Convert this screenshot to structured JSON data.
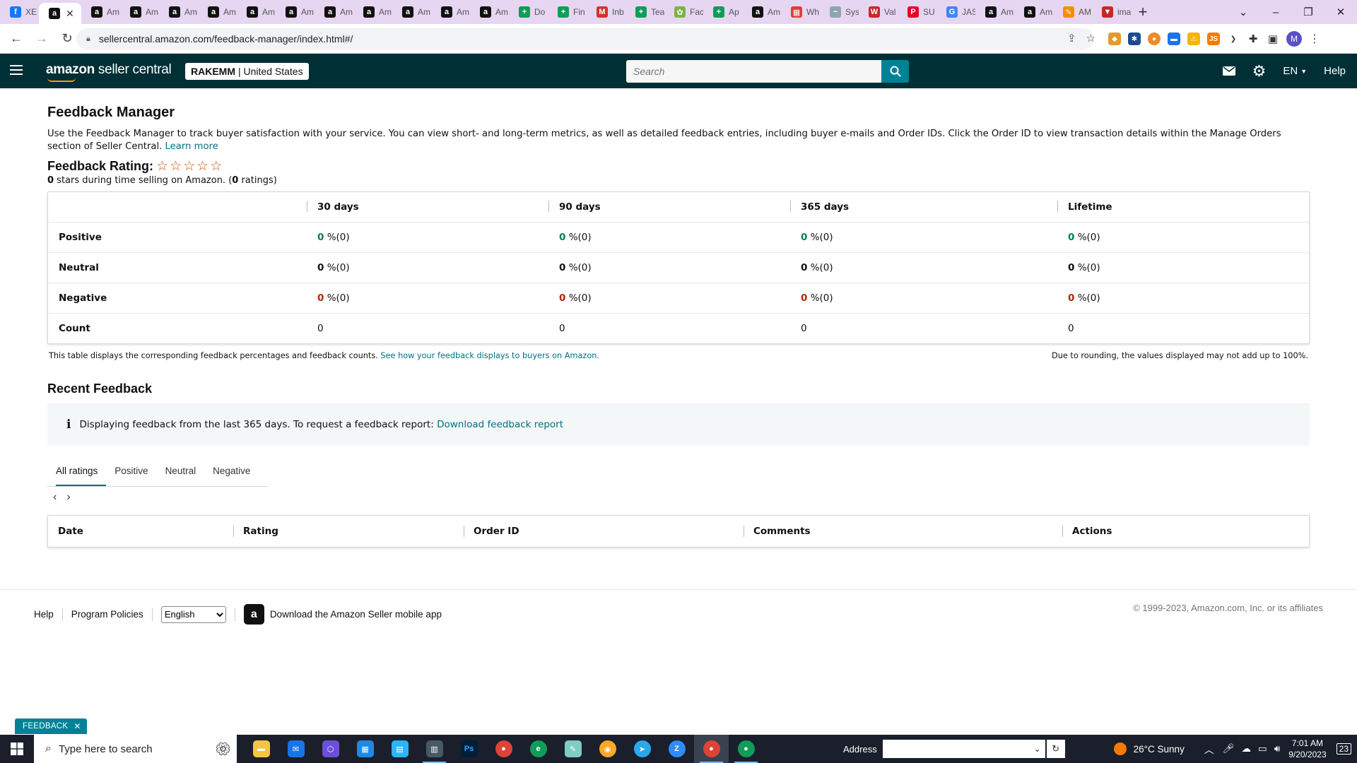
{
  "browser": {
    "tabs": [
      {
        "title": "XE",
        "fav": "facebook-icon",
        "color": "#1877f2",
        "glyph": "f"
      },
      {
        "title": "",
        "fav": "amazon-icon",
        "color": "#111111",
        "glyph": "a",
        "active": true
      },
      {
        "title": "Am",
        "fav": "amazon-icon",
        "color": "#111111",
        "glyph": "a"
      },
      {
        "title": "Am",
        "fav": "amazon-icon",
        "color": "#111111",
        "glyph": "a"
      },
      {
        "title": "Am",
        "fav": "amazon-icon",
        "color": "#111111",
        "glyph": "a"
      },
      {
        "title": "Am",
        "fav": "amazon-icon",
        "color": "#111111",
        "glyph": "a"
      },
      {
        "title": "Am",
        "fav": "amazon-icon",
        "color": "#111111",
        "glyph": "a"
      },
      {
        "title": "Am",
        "fav": "amazon-icon",
        "color": "#111111",
        "glyph": "a"
      },
      {
        "title": "Am",
        "fav": "amazon-icon",
        "color": "#111111",
        "glyph": "a"
      },
      {
        "title": "Am",
        "fav": "amazon-icon",
        "color": "#111111",
        "glyph": "a"
      },
      {
        "title": "Am",
        "fav": "amazon-icon",
        "color": "#111111",
        "glyph": "a"
      },
      {
        "title": "Am",
        "fav": "amazon-icon",
        "color": "#111111",
        "glyph": "a"
      },
      {
        "title": "Am",
        "fav": "amazon-icon",
        "color": "#111111",
        "glyph": "a"
      },
      {
        "title": "Do",
        "fav": "sheets-plus-icon",
        "color": "#0f9d58",
        "glyph": "+"
      },
      {
        "title": "Fin",
        "fav": "sheets-plus-icon",
        "color": "#0f9d58",
        "glyph": "+"
      },
      {
        "title": "Inb",
        "fav": "gmail-icon",
        "color": "#d93025",
        "glyph": "M"
      },
      {
        "title": "Tea",
        "fav": "sheets-plus-icon",
        "color": "#0f9d58",
        "glyph": "+"
      },
      {
        "title": "Fac",
        "fav": "leaf-icon",
        "color": "#7cb342",
        "glyph": "✿"
      },
      {
        "title": "Ap",
        "fav": "sheets-plus-icon",
        "color": "#0f9d58",
        "glyph": "+"
      },
      {
        "title": "Am",
        "fav": "amazon-icon",
        "color": "#111111",
        "glyph": "a"
      },
      {
        "title": "Wh",
        "fav": "grid-icon",
        "color": "#e53935",
        "glyph": "▦"
      },
      {
        "title": "Sys",
        "fav": "sys-icon",
        "color": "#90a4ae",
        "glyph": "~"
      },
      {
        "title": "Val",
        "fav": "val-icon",
        "color": "#c62828",
        "glyph": "W"
      },
      {
        "title": "SU",
        "fav": "pinterest-icon",
        "color": "#e60023",
        "glyph": "P"
      },
      {
        "title": "JAS",
        "fav": "google-icon",
        "color": "#4285f4",
        "glyph": "G"
      },
      {
        "title": "Am",
        "fav": "amazon-icon",
        "color": "#111111",
        "glyph": "a"
      },
      {
        "title": "Am",
        "fav": "amazon-icon",
        "color": "#111111",
        "glyph": "a"
      },
      {
        "title": "AM",
        "fav": "pencil-icon",
        "color": "#fb8c00",
        "glyph": "✎"
      },
      {
        "title": "ima",
        "fav": "triangle-icon",
        "color": "#c62828",
        "glyph": "▼"
      }
    ],
    "url": "sellercentral.amazon.com/feedback-manager/index.html#/"
  },
  "header": {
    "logo_bold": "amazon",
    "logo_rest": " seller central",
    "store_name": "RAKEMM",
    "store_region": "| United States",
    "search_placeholder": "Search",
    "language": "EN",
    "help": "Help",
    "accent": "#008296",
    "bg": "#002f36"
  },
  "page": {
    "title": "Feedback Manager",
    "intro": "Use the Feedback Manager to track buyer satisfaction with your service. You can view short- and long-term metrics, as well as detailed feedback entries, including buyer e-mails and Order IDs. Click the Order ID to view transaction details within the Manage Orders section of Seller Central.",
    "learn_more": "Learn more",
    "rating_label": "Feedback Rating:",
    "rating_stars": 0,
    "rating_sub_value": "0",
    "rating_sub_text": " stars during time selling on Amazon. (",
    "rating_sub_count": "0",
    "rating_sub_end": " ratings)"
  },
  "metrics": {
    "columns": [
      "",
      "30 days",
      "90 days",
      "365 days",
      "Lifetime"
    ],
    "rows": [
      {
        "label": "Positive",
        "kind": "pos",
        "cells": [
          {
            "v": "0",
            "p": "%(0)"
          },
          {
            "v": "0",
            "p": "%(0)"
          },
          {
            "v": "0",
            "p": "%(0)"
          },
          {
            "v": "0",
            "p": "%(0)"
          }
        ]
      },
      {
        "label": "Neutral",
        "kind": "neu",
        "cells": [
          {
            "v": "0",
            "p": "%(0)"
          },
          {
            "v": "0",
            "p": "%(0)"
          },
          {
            "v": "0",
            "p": "%(0)"
          },
          {
            "v": "0",
            "p": "%(0)"
          }
        ]
      },
      {
        "label": "Negative",
        "kind": "neg",
        "cells": [
          {
            "v": "0",
            "p": "%(0)"
          },
          {
            "v": "0",
            "p": "%(0)"
          },
          {
            "v": "0",
            "p": "%(0)"
          },
          {
            "v": "0",
            "p": "%(0)"
          }
        ]
      },
      {
        "label": "Count",
        "kind": "count",
        "cells": [
          {
            "v": "0",
            "p": ""
          },
          {
            "v": "0",
            "p": ""
          },
          {
            "v": "0",
            "p": ""
          },
          {
            "v": "0",
            "p": ""
          }
        ]
      }
    ],
    "note_left": "This table displays the corresponding feedback percentages and feedback counts.",
    "note_link": "See how your feedback displays to buyers on Amazon.",
    "note_right": "Due to rounding, the values displayed may not add up to 100%."
  },
  "recent": {
    "title": "Recent Feedback",
    "info_text": "Displaying feedback from the last 365 days. To request a feedback report:",
    "info_link": "Download feedback report",
    "tabs": [
      "All ratings",
      "Positive",
      "Neutral",
      "Negative"
    ],
    "active_tab": 0,
    "columns": [
      "Date",
      "Rating",
      "Order ID",
      "Comments",
      "Actions"
    ]
  },
  "footer": {
    "help": "Help",
    "policies": "Program Policies",
    "language": "English",
    "app_text": "Download the Amazon Seller mobile app",
    "copyright": "© 1999-2023, Amazon.com, Inc. or its affiliates",
    "feedback_btn": "FEEDBACK"
  },
  "taskbar": {
    "search_placeholder": "Type here to search",
    "address_label": "Address",
    "weather": "26°C  Sunny",
    "time": "7:01 AM",
    "date": "9/20/2023",
    "notif_count": "23"
  }
}
